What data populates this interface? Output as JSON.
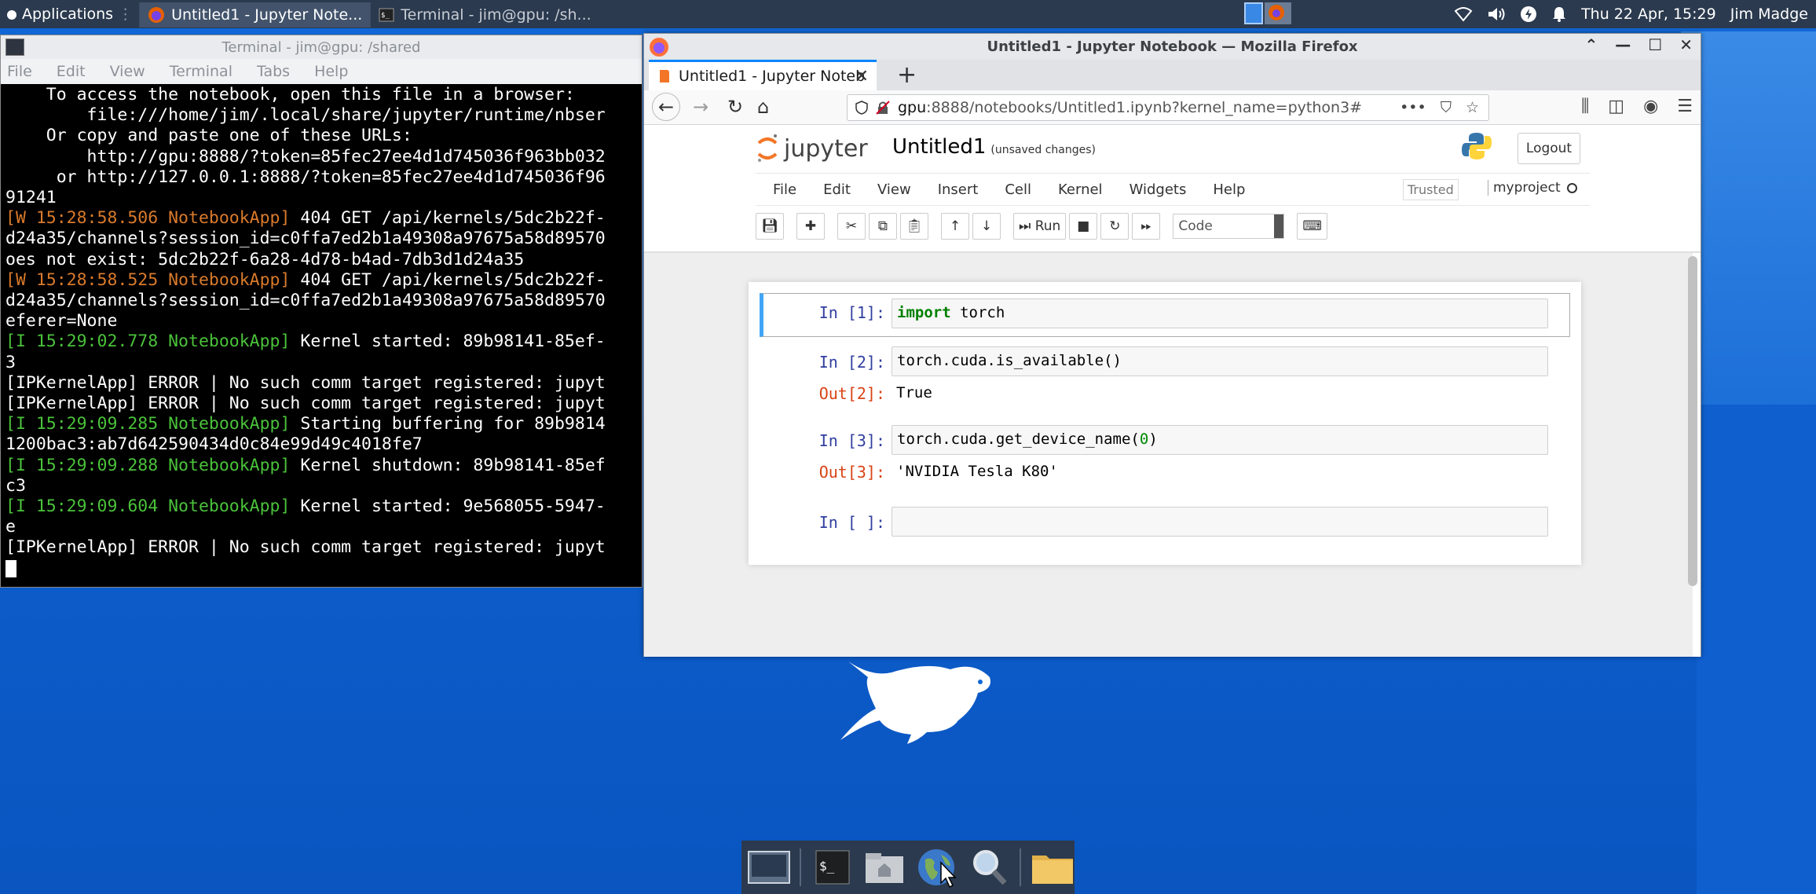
{
  "top_panel": {
    "applications": "Applications",
    "tasks": [
      {
        "label": "Untitled1 - Jupyter Note..."
      },
      {
        "label": "Terminal - jim@gpu: /sh..."
      }
    ],
    "datetime": "Thu 22 Apr, 15:29",
    "user": "Jim Madge"
  },
  "terminal": {
    "title": "Terminal - jim@gpu: /shared",
    "menu": [
      "File",
      "Edit",
      "View",
      "Terminal",
      "Tabs",
      "Help"
    ],
    "lines": [
      {
        "text": "    To access the notebook, open this file in a browser:",
        "style": ""
      },
      {
        "text": "        file:///home/jim/.local/share/jupyter/runtime/nbser",
        "style": ""
      },
      {
        "text": "    Or copy and paste one of these URLs:",
        "style": ""
      },
      {
        "text": "        http://gpu:8888/?token=85fec27ee4d1d745036f963bb032",
        "style": ""
      },
      {
        "text": "     or http://127.0.0.1:8888/?token=85fec27ee4d1d745036f96",
        "style": ""
      },
      {
        "text": "91241",
        "style": ""
      },
      {
        "prefix": "[W 15:28:58.506 NotebookApp]",
        "text": " 404 GET /api/kernels/5dc2b22f-",
        "style": "orange"
      },
      {
        "text": "d24a35/channels?session_id=c0ffa7ed2b1a49308a97675a58d89570",
        "style": ""
      },
      {
        "text": "oes not exist: 5dc2b22f-6a28-4d78-b4ad-7db3d1d24a35",
        "style": ""
      },
      {
        "prefix": "[W 15:28:58.525 NotebookApp]",
        "text": " 404 GET /api/kernels/5dc2b22f-",
        "style": "orange"
      },
      {
        "text": "d24a35/channels?session_id=c0ffa7ed2b1a49308a97675a58d89570",
        "style": ""
      },
      {
        "text": "eferer=None",
        "style": ""
      },
      {
        "prefix": "[I 15:29:02.778 NotebookApp]",
        "text": " Kernel started: 89b98141-85ef-",
        "style": "green"
      },
      {
        "text": "3",
        "style": ""
      },
      {
        "text": "[IPKernelApp] ERROR | No such comm target registered: jupyt",
        "style": ""
      },
      {
        "text": "[IPKernelApp] ERROR | No such comm target registered: jupyt",
        "style": ""
      },
      {
        "prefix": "[I 15:29:09.285 NotebookApp]",
        "text": " Starting buffering for 89b9814",
        "style": "green"
      },
      {
        "text": "1200bac3:ab7d642590434d0c84e99d49c4018fe7",
        "style": ""
      },
      {
        "prefix": "[I 15:29:09.288 NotebookApp]",
        "text": " Kernel shutdown: 89b98141-85ef",
        "style": "green"
      },
      {
        "text": "c3",
        "style": ""
      },
      {
        "prefix": "[I 15:29:09.604 NotebookApp]",
        "text": " Kernel started: 9e568055-5947-",
        "style": "green"
      },
      {
        "text": "e",
        "style": ""
      },
      {
        "text": "[IPKernelApp] ERROR | No such comm target registered: jupyt",
        "style": ""
      }
    ]
  },
  "firefox": {
    "title": "Untitled1 - Jupyter Notebook — Mozilla Firefox",
    "tab_label": "Untitled1 - Jupyter Noteb",
    "url_host": "gpu",
    "url_path": ":8888/notebooks/Untitled1.ipynb?kernel_name=python3#"
  },
  "jupyter": {
    "logo_text": "jupyter",
    "notebook_name": "Untitled1",
    "unsaved": "(unsaved changes)",
    "logout": "Logout",
    "menu": [
      "File",
      "Edit",
      "View",
      "Insert",
      "Cell",
      "Kernel",
      "Widgets",
      "Help"
    ],
    "trusted": "Trusted",
    "kernel_name": "myproject",
    "run_label": "Run",
    "cell_type": "Code",
    "cells": [
      {
        "prompt": "In [1]:",
        "code_kw": "import",
        "code_rest": " torch"
      },
      {
        "prompt": "In [2]:",
        "code": "torch.cuda.is_available()",
        "out_prompt": "Out[2]:",
        "output": "True"
      },
      {
        "prompt": "In [3]:",
        "code_pre": "torch.cuda.get_device_name(",
        "code_num": "0",
        "code_post": ")",
        "out_prompt": "Out[3]:",
        "output": "'NVIDIA Tesla K80'"
      },
      {
        "prompt": "In [ ]:"
      }
    ]
  }
}
